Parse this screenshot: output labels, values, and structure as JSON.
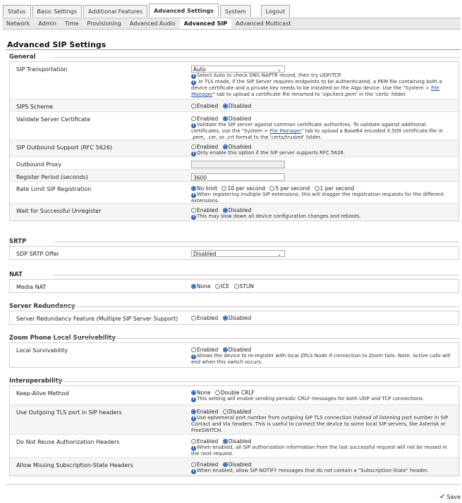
{
  "top_tabs": [
    "Status",
    "Basic Settings",
    "Additional Features",
    "Advanced Settings",
    "System",
    "Logout"
  ],
  "sub_tabs": [
    "Network",
    "Admin",
    "Time",
    "Provisioning",
    "Advanced Audio",
    "Advanced SIP",
    "Advanced Multicast"
  ],
  "page_title": "Advanced SIP Settings",
  "sections": {
    "general": {
      "title": "General",
      "sip_transport": {
        "label": "SIP Transportation",
        "value": "Auto",
        "hint1": "Select Auto to check DNS NAPTR record, then try UDP/TCP.",
        "hint2a": " In TLS mode, if the SIP Server requires endpoints to be authenticated, a PEM file containing both a device certificate and a private key needs to be installed on the Algo device. Use the \"System > ",
        "hint2_link": "File Manager",
        "hint2b": "\" tab to upload a certificate file renamed to 'sipclient.pem' in the 'certs' folder."
      },
      "sips_scheme": {
        "label": "SIPS Scheme",
        "opt1": "Enabled",
        "opt2": "Disabled"
      },
      "validate_cert": {
        "label": "Validate Server Certificate",
        "opt1": "Enabled",
        "opt2": "Disabled",
        "hint_a": "Validate the SIP server against common certificate authorities. To validate against additional certificates, use the \"System > ",
        "hint_link": "File Manager",
        "hint_b": "\" tab to upload a Base64 encoded X.509 certificate file in .pem, .cer, or .crt format to the 'certs/trusted' folder."
      },
      "outbound_support": {
        "label": "SIP Outbound Support (RFC 5626)",
        "opt1": "Enabled",
        "opt2": "Disabled",
        "hint": "Only enable this option if the SIP server supports RFC 5626."
      },
      "outbound_proxy": {
        "label": "Outbound Proxy",
        "value": ""
      },
      "register_period": {
        "label": "Register Period (seconds)",
        "value": "3600"
      },
      "rate_limit": {
        "label": "Rate Limit SIP Registration",
        "opt1": "No limit",
        "opt2": "10 per second",
        "opt3": "5 per second",
        "opt4": "1 per second",
        "hint": "When registering multiple SIP extensions, this will stagger the registration requests for the different extensions."
      },
      "wait_unregister": {
        "label": "Wait for Successful Unregister",
        "opt1": "Enabled",
        "opt2": "Disabled",
        "hint": "This may slow down all device configuration changes and reboots."
      }
    },
    "srtp": {
      "title": "SRTP",
      "sdp_offer": {
        "label": "SDP SRTP Offer",
        "value": "Disabled"
      }
    },
    "nat": {
      "title": "NAT",
      "media_nat": {
        "label": "Media NAT",
        "opt1": "None",
        "opt2": "ICE",
        "opt3": "STUN"
      }
    },
    "redundancy": {
      "title": "Server Redundancy",
      "feature": {
        "label": "Server Redundancy Feature (Multiple SIP Server Support)",
        "opt1": "Enabled",
        "opt2": "Disabled"
      }
    },
    "zoom": {
      "title": "Zoom Phone Local Survivability",
      "local": {
        "label": "Local Survivability",
        "opt1": "Enabled",
        "opt2": "Disabled",
        "hint": "Allows the device to re-register with local ZPLS Node if connection to Zoom fails. Note: Active calls will end when this switch occurs."
      }
    },
    "interop": {
      "title": "Interoperability",
      "keepalive": {
        "label": "Keep-Alive Method",
        "opt1": "None",
        "opt2": "Double CRLF",
        "hint": "This setting will enable sending periodic CRLF messages for both UDP and TCP connections."
      },
      "outgoing_tls": {
        "label": "Use Outgoing TLS port in SIP headers",
        "opt1": "Enabled",
        "opt2": "Disabled",
        "hint": "Use ephemeral port number from outgoing SIP TLS connection instead of listening port number in SIP Contact and Via headers. This is useful to connect the device to some local SIP servers, like Asterisk or FreeSWITCH."
      },
      "no_reuse_auth": {
        "label": "Do Not Reuse Authorization Headers",
        "opt1": "Enabled",
        "opt2": "Disabled",
        "hint": "When enabled, all SIP authorization information from the last successful request will not be reused in the next request."
      },
      "missing_sub": {
        "label": "Allow Missing Subscription-State Headers",
        "opt1": "Enabled",
        "opt2": "Disabled",
        "hint": "When enabled, allow SIP NOTIFY messages that do not contain a \"Subscription-State\" header."
      }
    }
  },
  "save_label": "Save",
  "colors": {
    "accent": "#1a5bbf",
    "link": "#1a4ea8",
    "save_check": "#2e9a2e"
  }
}
